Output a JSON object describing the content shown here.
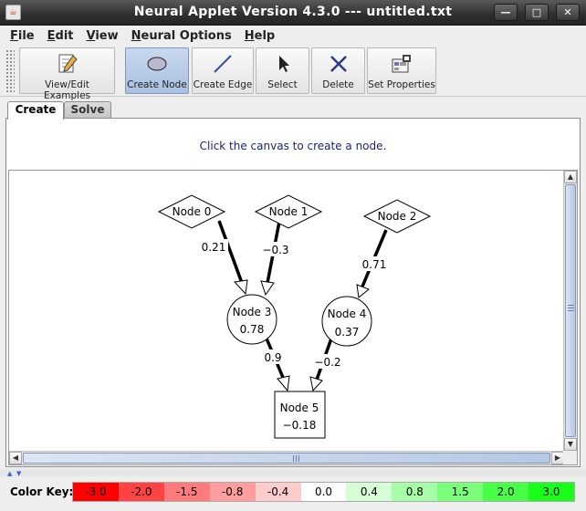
{
  "window": {
    "title": "Neural Applet Version 4.3.0 --- untitled.txt",
    "controls": [
      "minimize",
      "maximize",
      "close"
    ]
  },
  "menu": [
    "File",
    "Edit",
    "View",
    "Neural Options",
    "Help"
  ],
  "toolbar": [
    {
      "label": "View/Edit Examples",
      "icon": "edit-examples-icon",
      "active": false
    },
    {
      "label": "Create Node",
      "icon": "ellipse-icon",
      "active": true
    },
    {
      "label": "Create Edge",
      "icon": "line-icon",
      "active": false
    },
    {
      "label": "Select",
      "icon": "pointer-icon",
      "active": false
    },
    {
      "label": "Delete",
      "icon": "x-icon",
      "active": false
    },
    {
      "label": "Set Properties",
      "icon": "properties-icon",
      "active": false
    }
  ],
  "tabs": [
    {
      "label": "Create",
      "selected": true
    },
    {
      "label": "Solve",
      "selected": false
    }
  ],
  "message": "Click the canvas to create a node.",
  "graph": {
    "nodes": [
      {
        "id": "n0",
        "label": "Node 0",
        "shape": "diamond"
      },
      {
        "id": "n1",
        "label": "Node 1",
        "shape": "diamond"
      },
      {
        "id": "n2",
        "label": "Node 2",
        "shape": "diamond"
      },
      {
        "id": "n3",
        "label": "Node 3",
        "value": "0.78",
        "shape": "circle"
      },
      {
        "id": "n4",
        "label": "Node 4",
        "value": "0.37",
        "shape": "circle"
      },
      {
        "id": "n5",
        "label": "Node 5",
        "value": "−0.18",
        "shape": "square"
      }
    ],
    "edges": [
      {
        "from": "n0",
        "to": "n3",
        "weight": "0.21"
      },
      {
        "from": "n1",
        "to": "n3",
        "weight": "−0.3"
      },
      {
        "from": "n2",
        "to": "n4",
        "weight": "0.71"
      },
      {
        "from": "n3",
        "to": "n5",
        "weight": "0.9"
      },
      {
        "from": "n4",
        "to": "n5",
        "weight": "−0.2"
      }
    ]
  },
  "color_key": {
    "label": "Color Key:",
    "entries": [
      {
        "value": "-3.0",
        "color": "#ff0000"
      },
      {
        "value": "-2.0",
        "color": "#ff4242"
      },
      {
        "value": "-1.5",
        "color": "#ff7a7a"
      },
      {
        "value": "-0.8",
        "color": "#ff9e9e"
      },
      {
        "value": "-0.4",
        "color": "#ffcccc"
      },
      {
        "value": "0.0",
        "color": "#ffffff"
      },
      {
        "value": "0.4",
        "color": "#d6ffd6"
      },
      {
        "value": "0.8",
        "color": "#a6ffa6"
      },
      {
        "value": "1.5",
        "color": "#7aff7a"
      },
      {
        "value": "2.0",
        "color": "#48ff48"
      },
      {
        "value": "3.0",
        "color": "#1aff1a"
      }
    ]
  }
}
